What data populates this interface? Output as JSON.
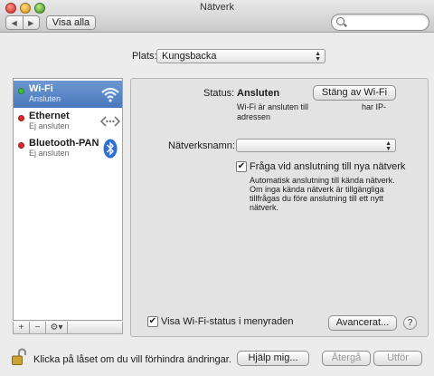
{
  "window": {
    "title": "Nätverk"
  },
  "toolbar": {
    "back_glyph": "◀",
    "forward_glyph": "▶",
    "show_all_label": "Visa alla",
    "search_placeholder": "",
    "search_value": ""
  },
  "location": {
    "label": "Plats:",
    "value": "Kungsbacka"
  },
  "services": [
    {
      "name": "Wi-Fi",
      "status": "Ansluten",
      "status_color": "#3cbf3c",
      "icon": "wifi-icon",
      "selected": true
    },
    {
      "name": "Ethernet",
      "status": "Ej ansluten",
      "status_color": "#d8292f",
      "icon": "ethernet-icon",
      "selected": false
    },
    {
      "name": "Bluetooth-PAN",
      "status": "Ej ansluten",
      "status_color": "#d8292f",
      "icon": "bluetooth-icon",
      "selected": false
    }
  ],
  "sidebar_buttons": {
    "add": "+",
    "remove": "−",
    "gear": "⚙▾"
  },
  "detail": {
    "status_label": "Status:",
    "status_value": "Ansluten",
    "turn_off_button": "Stäng av Wi-Fi",
    "status_desc_left": "Wi-Fi är ansluten till",
    "status_desc_right": "har IP-",
    "status_desc_line2": "adressen",
    "network_name_label": "Nätverksnamn:",
    "network_name_value": "",
    "ask_join_checked": true,
    "ask_join_label": "Fråga vid anslutning till nya nätverk",
    "ask_join_desc": "Automatisk anslutning till kända nätverk. Om inga kända nätverk är tillgängliga tillfrågas du före anslutning till ett nytt nätverk.",
    "show_status_checked": true,
    "show_status_label": "Visa Wi-Fi-status i menyraden",
    "advanced_button": "Avancerat...",
    "help_button": "?"
  },
  "bottom": {
    "lock_text": "Klicka på låset om du vill förhindra ändringar.",
    "assist_button": "Hjälp mig...",
    "revert_button": "Återgå",
    "apply_button": "Utför"
  },
  "colors": {
    "selection": "#5a86c5",
    "window_bg": "#ececec",
    "panel_bg": "#e3e3e3"
  }
}
